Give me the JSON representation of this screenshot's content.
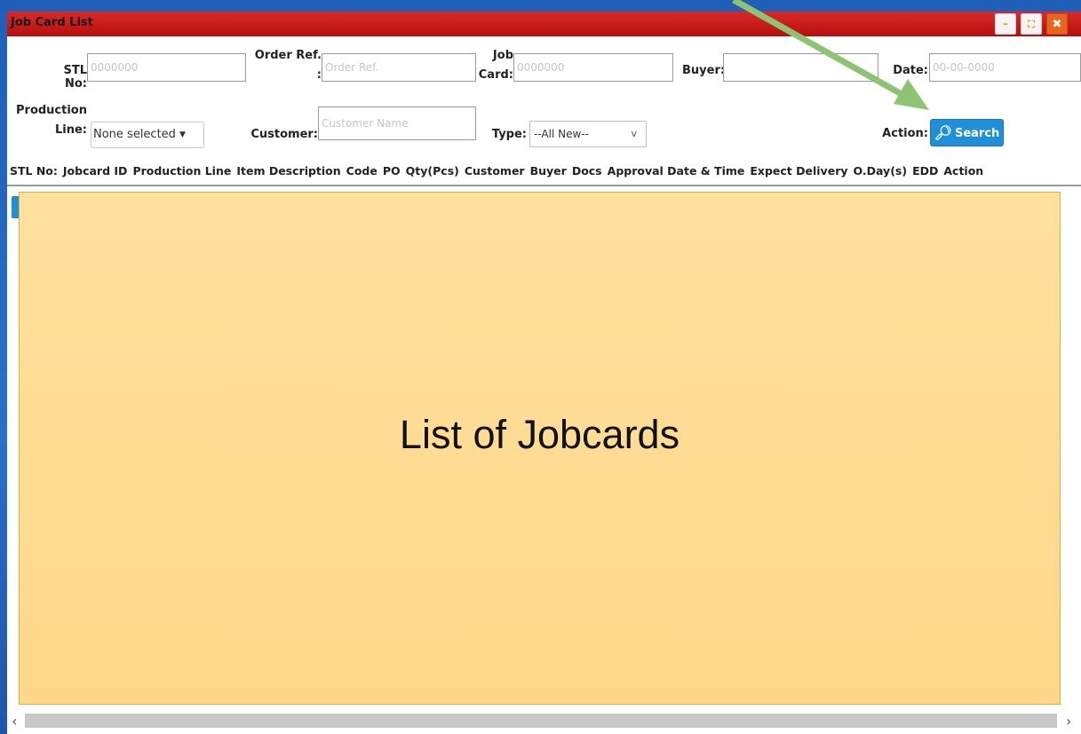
{
  "window": {
    "title": "Job Card List",
    "controls": {
      "minimize": "–",
      "maximize": "⛶",
      "close": "✖"
    }
  },
  "filters": {
    "stl_no": {
      "label": "STL No:",
      "placeholder": "0000000"
    },
    "order_ref": {
      "label_line1": "Order Ref.",
      "label_line2": ":",
      "placeholder": "Order Ref."
    },
    "job_card": {
      "label_line1": "Job",
      "label_line2": "Card:",
      "placeholder": "0000000"
    },
    "buyer": {
      "label": "Buyer:",
      "value": ""
    },
    "date": {
      "label": "Date:",
      "placeholder": "00-00-0000"
    },
    "production_line": {
      "label_line1": "Production",
      "label_line2": "Line:",
      "selected": "None selected"
    },
    "customer": {
      "label": "Customer:",
      "placeholder": "Customer Name"
    },
    "type": {
      "label": "Type:",
      "selected": "--All New--"
    },
    "action": {
      "label": "Action:",
      "search_label": "Search"
    }
  },
  "table": {
    "columns": [
      "STL No:",
      "Jobcard ID",
      "Production Line",
      "Item Description",
      "Code",
      "PO",
      "Qty(Pcs)",
      "Customer",
      "Buyer",
      "Docs",
      "Approval Date & Time",
      "Expect Delivery",
      "O.Day(s)",
      "EDD",
      "Action"
    ]
  },
  "overlay": {
    "text": "List of Jobcards"
  },
  "colors": {
    "titlebar": "#c81a1a",
    "accent": "#1e8fd8",
    "overlay": "#ffd98e",
    "arrow": "#8dc472"
  },
  "icons": {
    "search": "search-icon",
    "scroll_left": "chevron-left-icon",
    "scroll_right": "chevron-right-icon"
  }
}
